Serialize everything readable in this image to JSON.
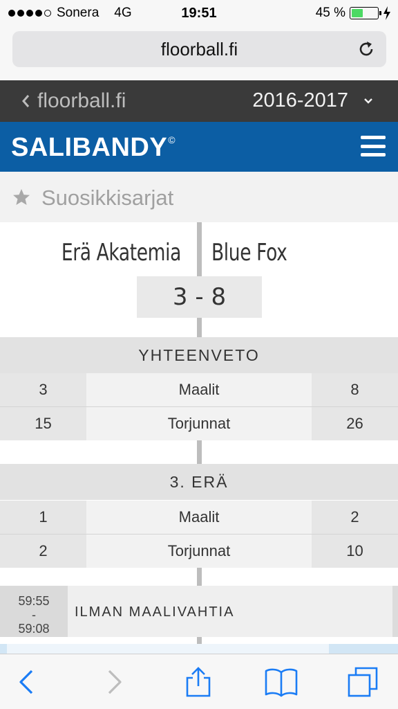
{
  "status_bar": {
    "carrier": "Sonera",
    "network": "4G",
    "time": "19:51",
    "battery_percent": "45 %",
    "battery_level": 0.45,
    "signal_bars": 4
  },
  "browser": {
    "url": "floorball.fi"
  },
  "site_bar": {
    "back_label": "floorball.fi",
    "season": "2016-2017"
  },
  "header": {
    "logo": "SALIBANDY",
    "logo_mark": "©",
    "color": "#0c5ea4"
  },
  "favourites": {
    "label": "Suosikkisarjat"
  },
  "match": {
    "home_team": "Erä Akatemia",
    "away_team": "Blue Fox",
    "score": "3 - 8"
  },
  "summary": {
    "title": "YHTEENVETO",
    "rows": [
      {
        "home": "3",
        "label": "Maalit",
        "away": "8"
      },
      {
        "home": "15",
        "label": "Torjunnat",
        "away": "26"
      }
    ]
  },
  "period": {
    "title": "3. ERÄ",
    "rows": [
      {
        "home": "1",
        "label": "Maalit",
        "away": "2"
      },
      {
        "home": "2",
        "label": "Torjunnat",
        "away": "10"
      }
    ]
  },
  "event": {
    "time_start": "59:55",
    "time_sep": "-",
    "time_end": "59:08",
    "description": "ILMAN MAALIVAHTIA"
  },
  "toolbar": {
    "icons": [
      "back-icon",
      "forward-icon",
      "share-icon",
      "bookmarks-icon",
      "tabs-icon"
    ],
    "accent": "#1a7cf5"
  }
}
